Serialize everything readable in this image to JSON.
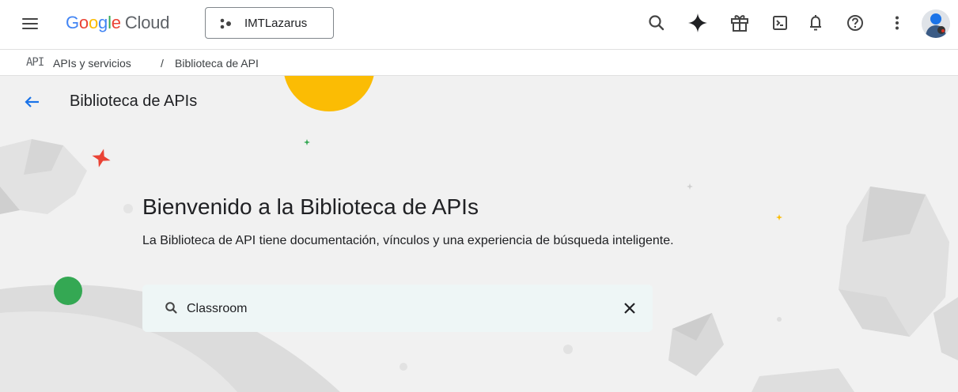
{
  "header": {
    "logo_google": [
      "G",
      "o",
      "o",
      "g",
      "l",
      "e"
    ],
    "logo_cloud": "Cloud",
    "project_name": "IMTLazarus",
    "icons": [
      "menu-icon",
      "search-icon",
      "gemini-icon",
      "gift-icon",
      "cloud-shell-icon",
      "notifications-icon",
      "help-icon",
      "more-vert-icon",
      "avatar"
    ]
  },
  "breadcrumb": {
    "icon_text": "API",
    "section": "APIs y servicios",
    "separator": "/",
    "current": "Biblioteca de API"
  },
  "page": {
    "title": "Biblioteca de APIs"
  },
  "hero": {
    "welcome": "Bienvenido a la Biblioteca de APIs",
    "subtitle": "La Biblioteca de API tiene documentación, vínculos y una experiencia de búsqueda inteligente."
  },
  "search": {
    "value": "Classroom"
  },
  "colors": {
    "google_blue": "#4285f4",
    "google_red": "#ea4335",
    "google_yellow": "#fbbc04",
    "google_green": "#34a853",
    "hero_bg": "#f1f1f1",
    "search_bg": "#eef6f6"
  }
}
